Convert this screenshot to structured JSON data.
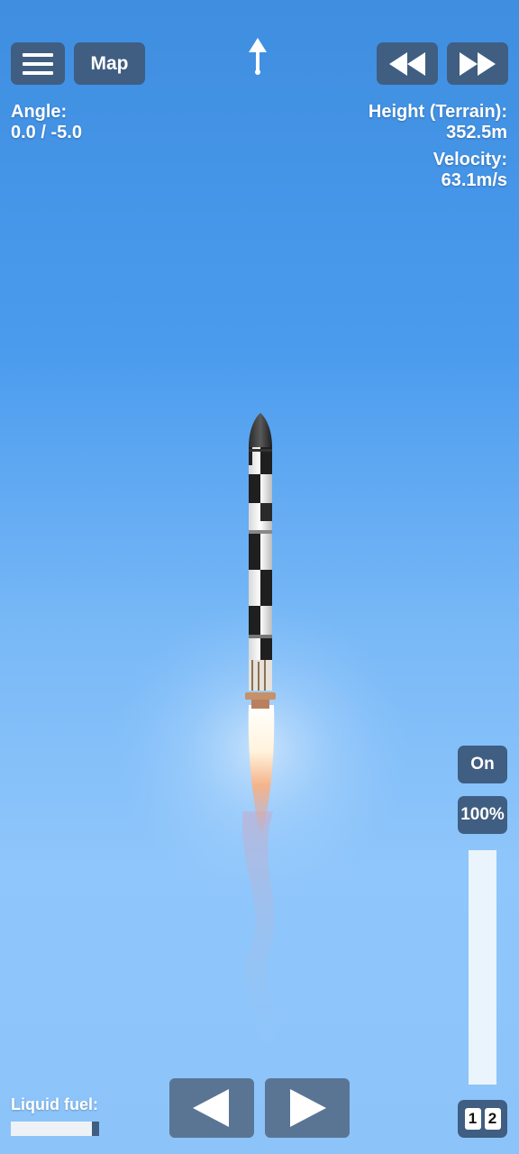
{
  "toolbar": {
    "menu_icon": "hamburger-menu-icon",
    "map_label": "Map",
    "heading_icon": "up-arrow-icon",
    "rewind_icon": "rewind-icon",
    "fast_forward_icon": "fast-forward-icon"
  },
  "telemetry": {
    "angle_label": "Angle:",
    "angle_value": "0.0 / -5.0",
    "height_label": "Height (Terrain):",
    "height_value": "352.5m",
    "velocity_label": "Velocity:",
    "velocity_value": "63.1m/s"
  },
  "engine": {
    "toggle_label": "On",
    "throttle_label": "100%",
    "throttle_level": 1.0
  },
  "stages": {
    "stage_1": "1",
    "stage_2": "2"
  },
  "fuel": {
    "label": "Liquid fuel:",
    "level": 0.92
  },
  "controls": {
    "left_icon": "turn-left-arrow-icon",
    "right_icon": "turn-right-arrow-icon"
  },
  "colors": {
    "button": "#3f5e82",
    "control_button": "#5a7594",
    "sky_top": "#3f8ee0",
    "sky_bottom": "#8cc4fa"
  }
}
